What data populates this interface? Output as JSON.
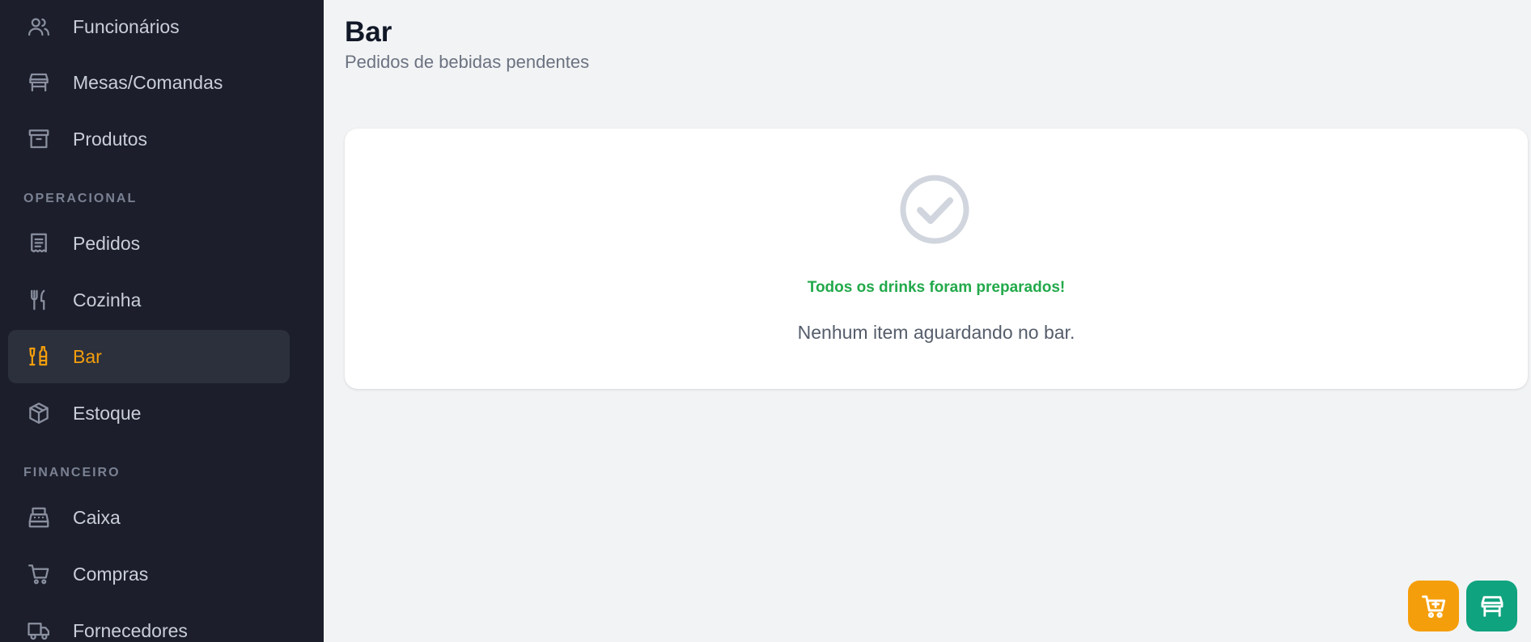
{
  "sidebar": {
    "items_top": [
      {
        "label": "Funcionários",
        "icon": "users-icon"
      },
      {
        "label": "Mesas/Comandas",
        "icon": "table-icon"
      },
      {
        "label": "Produtos",
        "icon": "archive-icon"
      }
    ],
    "section_operacional": "OPERACIONAL",
    "items_operacional": [
      {
        "label": "Pedidos",
        "icon": "receipt-icon"
      },
      {
        "label": "Cozinha",
        "icon": "utensils-icon"
      },
      {
        "label": "Bar",
        "icon": "bottles-icon",
        "active": true
      },
      {
        "label": "Estoque",
        "icon": "package-icon"
      }
    ],
    "section_financeiro": "FINANCEIRO",
    "items_financeiro": [
      {
        "label": "Caixa",
        "icon": "cash-register-icon"
      },
      {
        "label": "Compras",
        "icon": "cart-icon"
      },
      {
        "label": "Fornecedores",
        "icon": "truck-icon"
      }
    ]
  },
  "header": {
    "title": "Bar",
    "subtitle": "Pedidos de bebidas pendentes"
  },
  "empty_state": {
    "icon": "check-circle-icon",
    "title": "Todos os drinks foram preparados!",
    "message": "Nenhum item aguardando no bar."
  },
  "fabs": [
    {
      "icon": "add-to-cart-icon"
    },
    {
      "icon": "table-icon"
    }
  ],
  "colors": {
    "sidebar_bg": "#1c1f2b",
    "active_accent": "#f59e0b",
    "success": "#22a94a",
    "fab_orange": "#f59e0b",
    "fab_green": "#10a37f"
  }
}
